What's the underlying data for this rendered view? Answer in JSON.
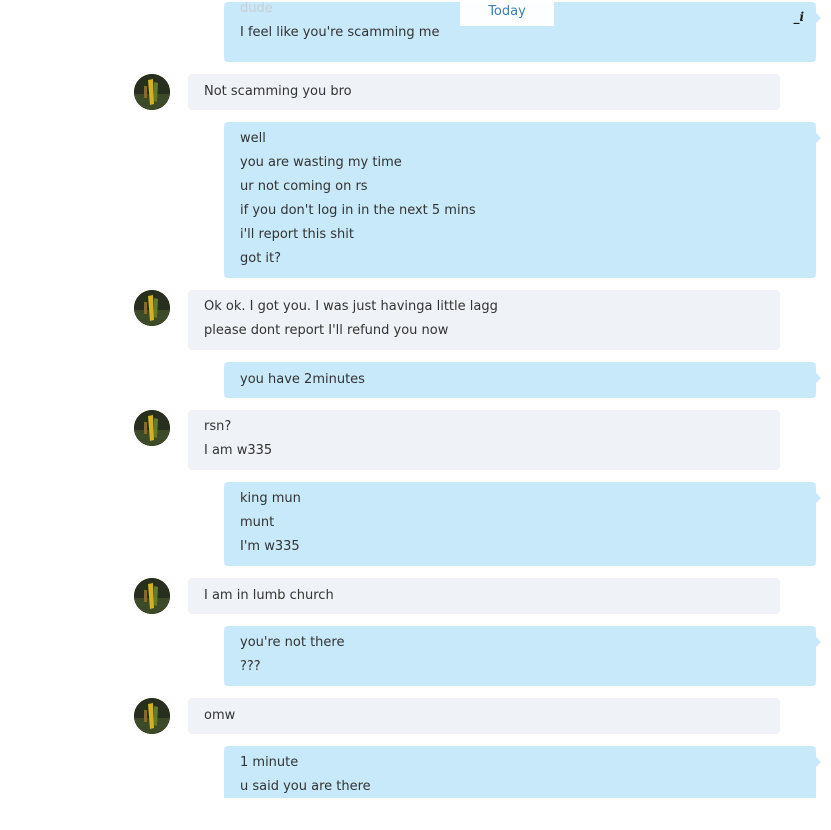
{
  "date_separator": "Today",
  "messages": [
    {
      "dir": "out",
      "lines": [
        "dude",
        "I feel like you're scamming me"
      ],
      "faded_first": true,
      "edited": true,
      "edit_glyph": "_i"
    },
    {
      "dir": "in",
      "lines": [
        "Not scamming you bro"
      ]
    },
    {
      "dir": "out",
      "lines": [
        "well",
        "you are wasting my time",
        "ur not coming on rs",
        "if you don't log in in the next 5 mins",
        "i'll report this shit",
        "got it?"
      ]
    },
    {
      "dir": "in",
      "lines": [
        "Ok ok. I got you. I was just havinga little lagg",
        "please dont report I'll refund you now"
      ]
    },
    {
      "dir": "out",
      "lines": [
        "you have 2minutes"
      ]
    },
    {
      "dir": "in",
      "lines": [
        "rsn?",
        "I am w335"
      ]
    },
    {
      "dir": "out",
      "lines": [
        "king mun",
        "munt",
        "I'm w335"
      ]
    },
    {
      "dir": "in",
      "lines": [
        "I am in lumb church"
      ]
    },
    {
      "dir": "out",
      "lines": [
        "you're not there",
        "???"
      ]
    },
    {
      "dir": "in",
      "lines": [
        "omw"
      ]
    },
    {
      "dir": "out",
      "lines": [
        "1 minute",
        "u said you are there"
      ]
    }
  ]
}
